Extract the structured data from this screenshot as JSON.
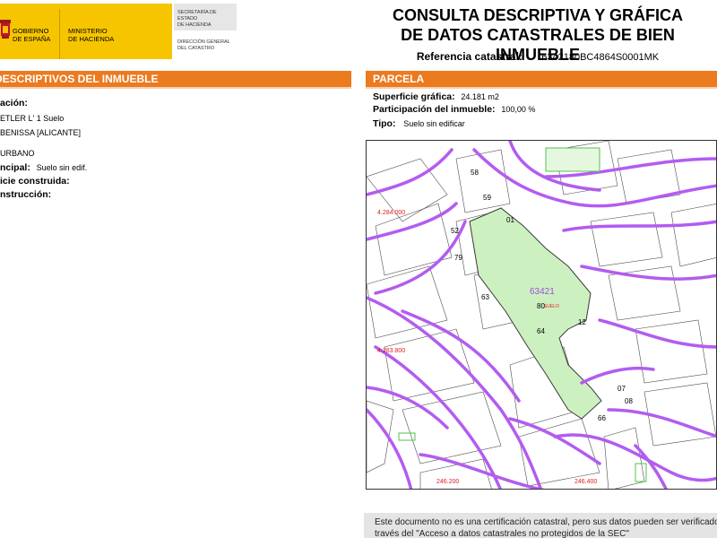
{
  "header": {
    "gov_line1": "GOBIERNO",
    "gov_line2": "DE ESPAÑA",
    "min_line1": "MINISTERIO",
    "min_line2": "DE HACIENDA",
    "sec_line1": "SECRETARÍA DE ESTADO",
    "sec_line2": "DE HACIENDA",
    "dg_line1": "DIRECCIÓN GENERAL",
    "dg_line2": "DEL CATASTRO",
    "title_line1": "CONSULTA DESCRIPTIVA Y GRÁFICA",
    "title_line2": "DE DATOS CATASTRALES DE BIEN INMUEBLE",
    "ref_label": "Referencia catastral:",
    "ref_value": "6342180BC4864S0001MK"
  },
  "left": {
    "bar_title": "DESCRIPTIVOS DEL INMUEBLE",
    "location_label": "ación:",
    "address_line1": "ETLER L' 1 Suelo",
    "address_line2": "BENISSA [ALICANTE]",
    "class_value": "URBANO",
    "use_label": "ncipal:",
    "use_value": "Suelo sin edif.",
    "built_label": "icie construida:",
    "year_label": "nstrucción:"
  },
  "right": {
    "bar_title": "PARCELA",
    "surface_label": "Superficie gráfica:",
    "surface_value": "24.181 m2",
    "share_label": "Participación del inmueble:",
    "share_value": "100,00 %",
    "type_label": "Tipo:",
    "type_value": "Suelo sin edificar"
  },
  "map": {
    "parcel_label": "63421",
    "parcel_sub": "80",
    "parcel_tag": "SUELO",
    "numbers": [
      "58",
      "59",
      "01",
      "52",
      "79",
      "63",
      "64",
      "12",
      "07",
      "08",
      "66"
    ],
    "coord_left_top": "4.284.000",
    "coord_left_mid": "4.283.800",
    "coord_bottom_1": "246.200",
    "coord_bottom_2": "246.400",
    "parcel_color": "#cdf0c0",
    "line_color": "#b35cf0"
  },
  "notice": {
    "line1": "Este documento no es una certificación catastral, pero sus datos pueden ser verificados",
    "line2": "través del \"Acceso a datos catastrales no protegidos de la SEC\""
  }
}
